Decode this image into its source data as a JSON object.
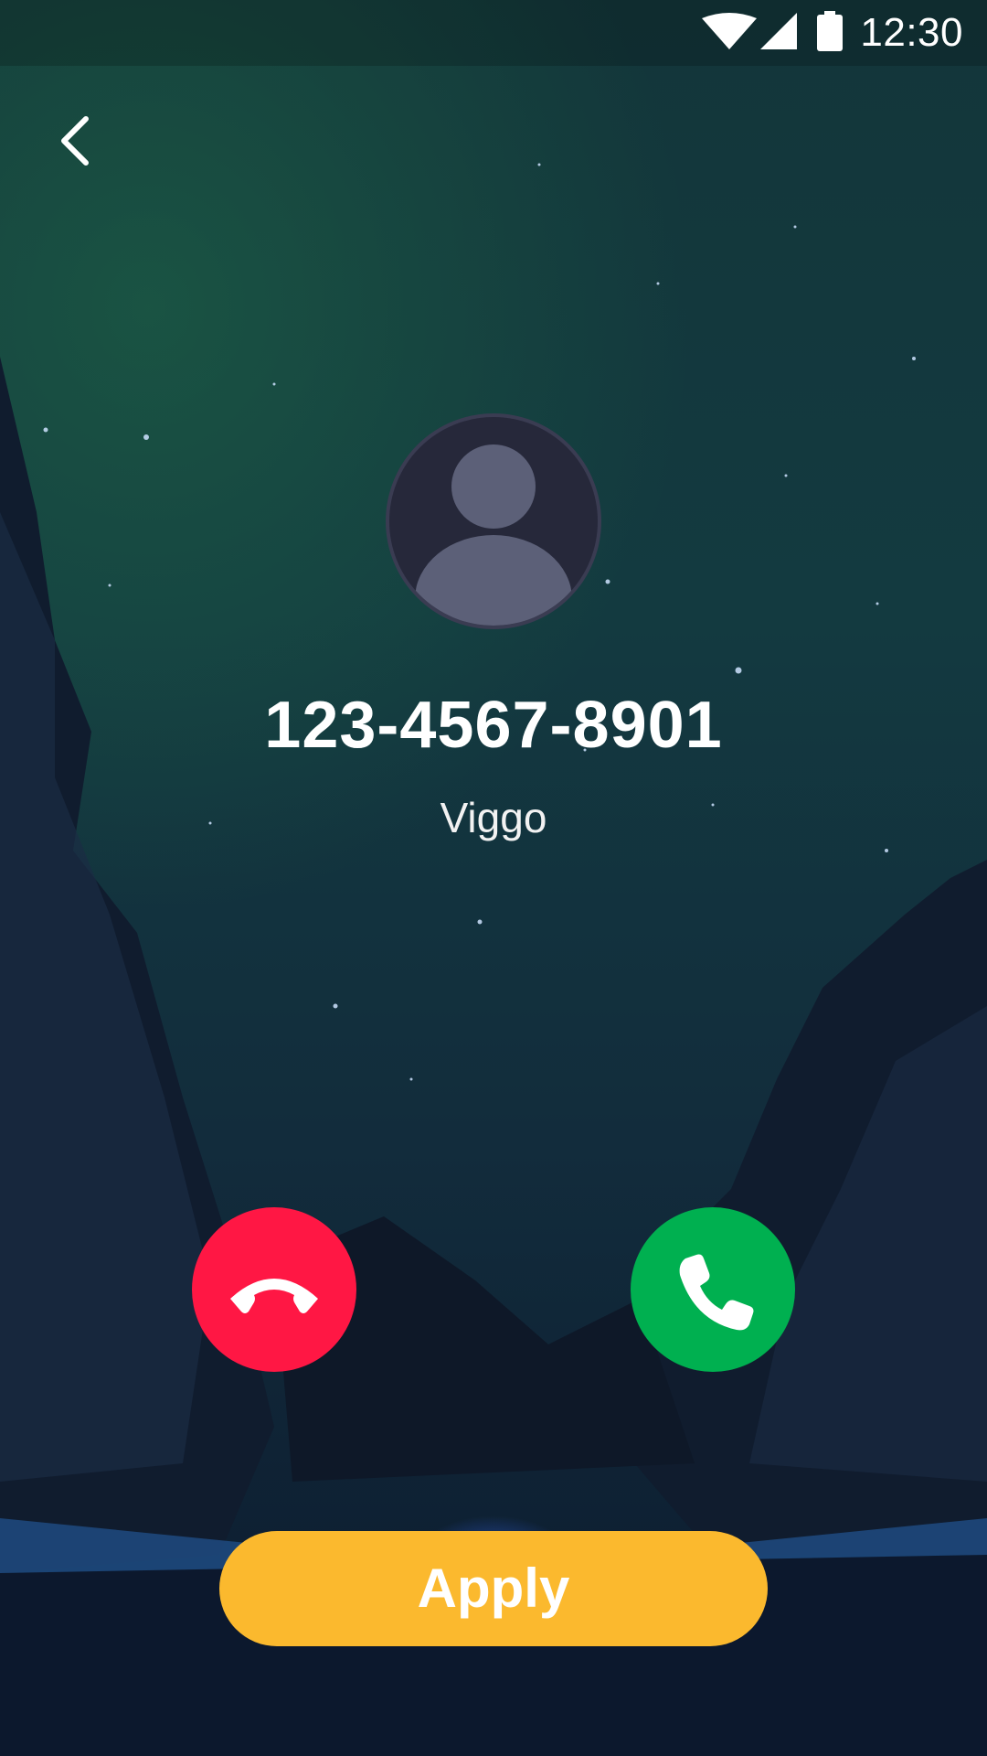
{
  "status_bar": {
    "time": "12:30",
    "icons": [
      "wifi-icon",
      "signal-icon",
      "battery-icon"
    ]
  },
  "navigation": {
    "back_icon": "chevron-left-icon"
  },
  "caller": {
    "avatar_icon": "person-avatar-icon",
    "phone_number": "123-4567-8901",
    "name": "Viggo"
  },
  "call_actions": {
    "decline_icon": "phone-hangup-icon",
    "accept_icon": "phone-icon",
    "decline_color": "#ff1744",
    "accept_color": "#00b050"
  },
  "apply_button": {
    "label": "Apply",
    "color": "#fbb92e"
  }
}
